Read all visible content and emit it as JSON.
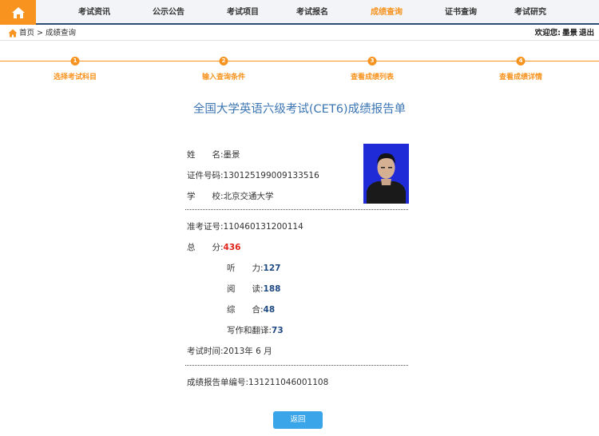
{
  "nav": {
    "items": [
      {
        "label": "考试资讯",
        "active": false
      },
      {
        "label": "公示公告",
        "active": false
      },
      {
        "label": "考试项目",
        "active": false
      },
      {
        "label": "考试报名",
        "active": false
      },
      {
        "label": "成绩查询",
        "active": true
      },
      {
        "label": "证书查询",
        "active": false
      },
      {
        "label": "考试研究",
        "active": false
      }
    ],
    "home_icon": "home-icon"
  },
  "breadcrumb": {
    "home": "首页",
    "separator": ">",
    "current": "成绩查询"
  },
  "user": {
    "welcome_label": "欢迎您:",
    "name": "墨景",
    "logout": "退出"
  },
  "steps": [
    {
      "number": "1",
      "label": "选择考试科目"
    },
    {
      "number": "2",
      "label": "输入查询条件"
    },
    {
      "number": "3",
      "label": "查看成绩列表"
    },
    {
      "number": "4",
      "label": "查看成绩详情"
    }
  ],
  "report": {
    "title": "全国大学英语六级考试(CET6)成绩报告单",
    "name_label": "姓　　名:",
    "name_value": "墨景",
    "id_label": "证件号码:",
    "id_value": "130125199009133516",
    "school_label": "学　　校:",
    "school_value": "北京交通大学",
    "ticket_label": "准考证号:",
    "ticket_value": "110460131200114",
    "total_label": "总　　分:",
    "total_value": "436",
    "listening_label": "听　　力:",
    "listening_value": "127",
    "reading_label": "阅　　读:",
    "reading_value": "188",
    "comprehensive_label": "综　　合:",
    "comprehensive_value": "48",
    "writing_label": "写作和翻译:",
    "writing_value": "73",
    "exam_time_label": "考试时间:",
    "exam_time_value": "2013年 6 月",
    "report_no_label": "成绩报告单编号:",
    "report_no_value": "131211046001108"
  },
  "back_button": "返回",
  "colors": {
    "accent": "#f7931e",
    "title_blue": "#3b75b3",
    "total_red": "#e0251b",
    "score_blue": "#1f4a82",
    "button_blue": "#3aa5e8",
    "nav_border": "#2f4c75"
  }
}
